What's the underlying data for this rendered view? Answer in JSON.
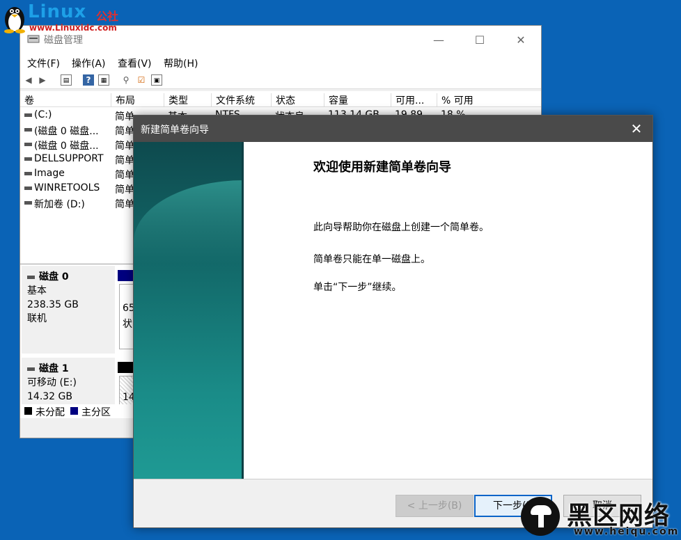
{
  "watermark_top": {
    "brand": "Linux",
    "brand_cn": "公社",
    "url": "www.Linuxidc.com"
  },
  "disk_mgmt": {
    "title": "磁盘管理",
    "menu": [
      "文件(F)",
      "操作(A)",
      "查看(V)",
      "帮助(H)"
    ],
    "columns": [
      "卷",
      "布局",
      "类型",
      "文件系统",
      "状态",
      "容量",
      "可用...",
      "% 可用"
    ],
    "volumes": [
      {
        "name": "(C:)",
        "layout": "简单",
        "type": "基本",
        "fs": "NTFS",
        "status": "状态良",
        "capacity": "113.14 GB",
        "free": "19.89",
        "pct": "18 %"
      },
      {
        "name": "(磁盘 0 磁盘...",
        "layout": "简单"
      },
      {
        "name": "(磁盘 0 磁盘...",
        "layout": "简单"
      },
      {
        "name": "DELLSUPPORT",
        "layout": "简单"
      },
      {
        "name": "Image",
        "layout": "简单"
      },
      {
        "name": "WINRETOOLS",
        "layout": "简单"
      },
      {
        "name": "新加卷 (D:)",
        "layout": "简单"
      }
    ],
    "disks": [
      {
        "name": "磁盘 0",
        "kind": "基本",
        "size": "238.35 GB",
        "state": "联机",
        "part_text1": "65",
        "part_text2": "状"
      },
      {
        "name": "磁盘 1",
        "kind": "可移动 (E:)",
        "size": "14.32 GB",
        "part_text1": "14"
      }
    ],
    "legend": [
      {
        "label": "未分配",
        "color": "#000000"
      },
      {
        "label": "主分区",
        "color": "#000080"
      }
    ]
  },
  "wizard": {
    "title": "新建简单卷向导",
    "heading": "欢迎使用新建简单卷向导",
    "para1": "此向导帮助你在磁盘上创建一个简单卷。",
    "para2": "简单卷只能在单一磁盘上。",
    "para3": "单击“下一步”继续。",
    "back_label": "< 上一步(B)",
    "next_label": "下一步(N",
    "cancel_label": "取消"
  },
  "watermark_br": {
    "brand": "黑区网络",
    "url": "www.heiqu.com"
  }
}
